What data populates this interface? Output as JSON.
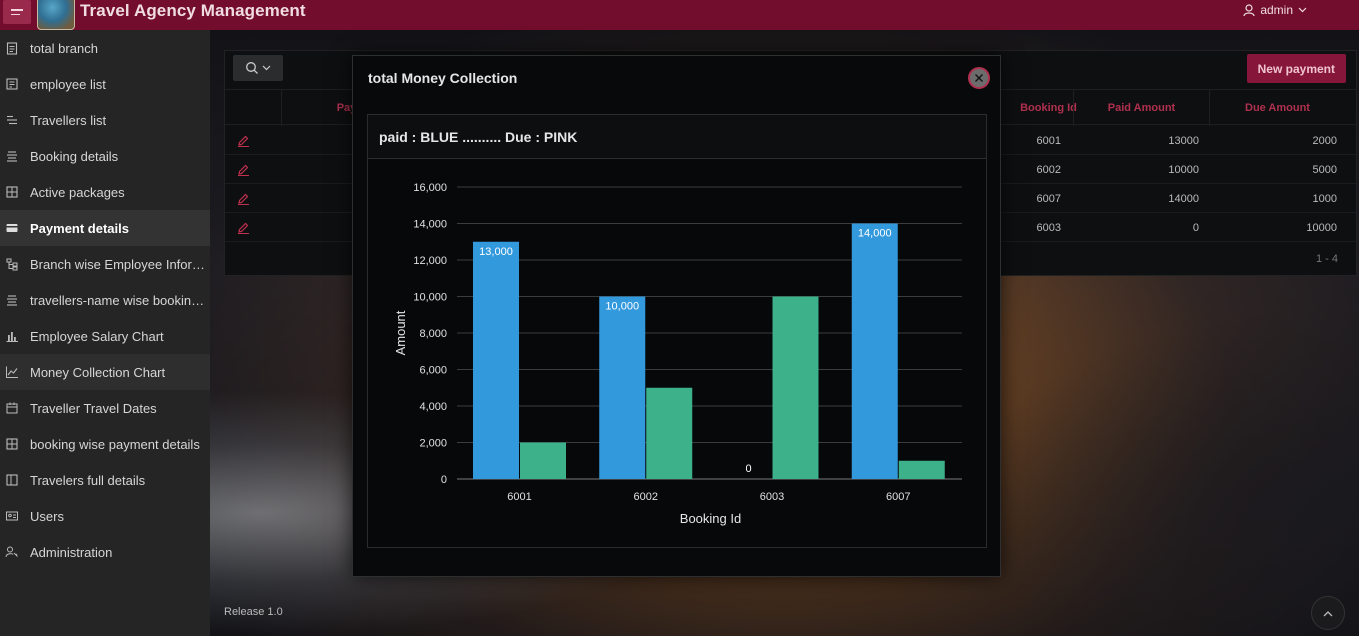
{
  "header": {
    "app_title": "Travel Agency Management",
    "user": "admin",
    "menu_icon": "hamburger-icon",
    "user_icon": "user-icon",
    "accent": "#730d2e"
  },
  "sidebar": {
    "items": [
      {
        "label": "total branch",
        "icon": "clipboard-icon"
      },
      {
        "label": "employee list",
        "icon": "id-card-icon"
      },
      {
        "label": "Travellers list",
        "icon": "list-icon"
      },
      {
        "label": "Booking details",
        "icon": "lines-icon"
      },
      {
        "label": "Active packages",
        "icon": "grid-icon"
      },
      {
        "label": "Payment details",
        "icon": "card-icon"
      },
      {
        "label": "Branch wise Employee Information",
        "icon": "hierarchy-icon"
      },
      {
        "label": "travellers-name wise booking info",
        "icon": "lines-icon"
      },
      {
        "label": "Employee Salary Chart",
        "icon": "bar-chart-icon"
      },
      {
        "label": "Money Collection Chart",
        "icon": "line-chart-icon"
      },
      {
        "label": "Traveller Travel Dates",
        "icon": "calendar-icon"
      },
      {
        "label": "booking wise payment details",
        "icon": "grid-icon"
      },
      {
        "label": "Travelers full details",
        "icon": "columns-icon"
      },
      {
        "label": "Users",
        "icon": "id-badge-icon"
      },
      {
        "label": "Administration",
        "icon": "user-key-icon"
      }
    ]
  },
  "report": {
    "new_payment_label": "New payment",
    "columns": [
      "Pay",
      "Booking Id",
      "Paid Amount",
      "Due Amount"
    ],
    "rows": [
      {
        "booking_id": "6001",
        "paid": "13000",
        "due": "2000"
      },
      {
        "booking_id": "6002",
        "paid": "10000",
        "due": "5000"
      },
      {
        "booking_id": "6007",
        "paid": "14000",
        "due": "1000"
      },
      {
        "booking_id": "6003",
        "paid": "0",
        "due": "10000"
      }
    ],
    "pagination": "1 - 4"
  },
  "footer": {
    "release": "Release 1.0"
  },
  "modal": {
    "title": "total Money Collection",
    "region_title": "paid : BLUE .......... Due : PINK"
  },
  "chart_data": {
    "type": "bar",
    "categories": [
      "6001",
      "6002",
      "6003",
      "6007"
    ],
    "series": [
      {
        "values": [
          13000,
          10000,
          0,
          14000
        ],
        "color": "#3399dd",
        "labels": [
          "13,000",
          "10,000",
          "0",
          "14,000"
        ]
      },
      {
        "values": [
          2000,
          5000,
          10000,
          1000
        ],
        "color": "#3cb18a"
      }
    ],
    "xlabel": "Booking Id",
    "ylabel": "Amount",
    "ylim": [
      0,
      16000
    ],
    "yticks": [
      "0",
      "2,000",
      "4,000",
      "6,000",
      "8,000",
      "10,000",
      "12,000",
      "14,000",
      "16,000"
    ],
    "grid": true
  }
}
